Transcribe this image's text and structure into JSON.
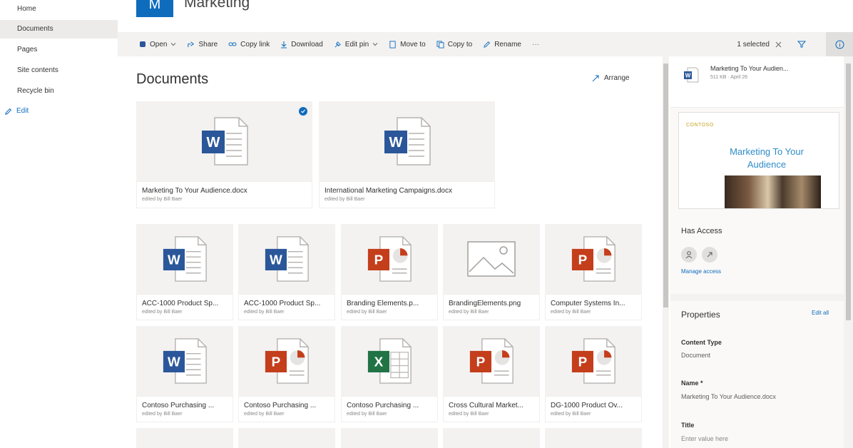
{
  "nav": {
    "items": [
      "Home",
      "Documents",
      "Pages",
      "Site contents",
      "Recycle bin"
    ],
    "edit": "Edit"
  },
  "site": {
    "logo_letter": "M",
    "title": "Marketing"
  },
  "cmdbar": {
    "open": "Open",
    "share": "Share",
    "copy_link": "Copy link",
    "download": "Download",
    "edit_pin": "Edit pin",
    "move_to": "Move to",
    "copy_to": "Copy to",
    "rename": "Rename",
    "more": "···",
    "selected": "1 selected"
  },
  "main": {
    "title": "Documents",
    "arrange": "Arrange",
    "pinned": [
      {
        "name": "Marketing To Your Audience.docx",
        "sub": "edited by Bill Baer",
        "type": "word",
        "selected": true
      },
      {
        "name": "International Marketing Campaigns.docx",
        "sub": "edited by Bill Baer",
        "type": "word",
        "selected": false
      }
    ],
    "files": [
      {
        "name": "ACC-1000 Product Sp...",
        "sub": "edited by Bill Baer",
        "type": "word"
      },
      {
        "name": "ACC-1000 Product Sp...",
        "sub": "edited by Bill Baer",
        "type": "word"
      },
      {
        "name": "Branding Elements.p...",
        "sub": "edited by Bill Baer",
        "type": "ppt"
      },
      {
        "name": "BrandingElements.png",
        "sub": "edited by Bill Baer",
        "type": "image"
      },
      {
        "name": "Computer Systems In...",
        "sub": "edited by Bill Baer",
        "type": "ppt"
      },
      {
        "name": "Contoso Purchasing ...",
        "sub": "edited by Bill Baer",
        "type": "word"
      },
      {
        "name": "Contoso Purchasing ...",
        "sub": "edited by Bill Baer",
        "type": "ppt"
      },
      {
        "name": "Contoso Purchasing ...",
        "sub": "edited by Bill Baer",
        "type": "excel"
      },
      {
        "name": "Cross Cultural Market...",
        "sub": "edited by Bill Baer",
        "type": "ppt"
      },
      {
        "name": "DG-1000 Product Ov...",
        "sub": "edited by Bill Baer",
        "type": "ppt"
      }
    ]
  },
  "pane": {
    "file_name": "Marketing To Your Audien...",
    "file_sub": "511 KB · April 26",
    "preview_brand": "CONTOSO",
    "preview_title": "Marketing To Your Audience",
    "has_access": "Has Access",
    "manage_access": "Manage access",
    "properties": "Properties",
    "edit_all": "Edit all",
    "content_type_label": "Content Type",
    "content_type_value": "Document",
    "name_label": "Name *",
    "name_value": "Marketing To Your Audience.docx",
    "title_label": "Title",
    "title_placeholder": "Enter value here"
  },
  "colors": {
    "accent": "#0f6cbd",
    "word": "#2b579a",
    "ppt": "#c43e1c",
    "excel": "#217346"
  }
}
